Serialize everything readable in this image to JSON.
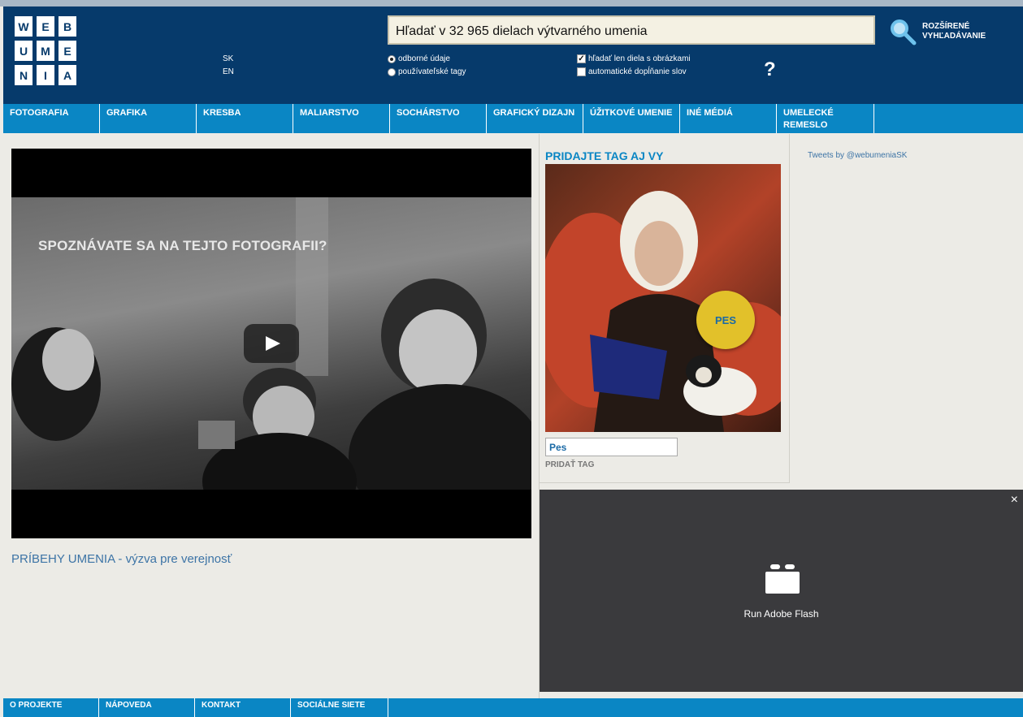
{
  "logo": {
    "letters": [
      "W",
      "E",
      "B",
      "U",
      "M",
      "E",
      "N",
      "I",
      "A"
    ]
  },
  "languages": [
    "SK",
    "EN"
  ],
  "search": {
    "value": "Hľadať v 32 965 dielach výtvarného umenia"
  },
  "search_options": {
    "odborne": "odborné údaje",
    "tagy": "používateľské tagy",
    "obrazky": "hľadať len diela s obrázkami",
    "doplnanie": "automatické dopĺňanie slov"
  },
  "help": "?",
  "advanced": {
    "line1": "ROZŠÍRENÉ",
    "line2": "VYHĽADÁVANIE"
  },
  "nav": [
    "FOTOGRAFIA",
    "GRAFIKA",
    "KRESBA",
    "MALIARSTVO",
    "SOCHÁRSTVO",
    "GRAFICKÝ DIZAJN",
    "ÚŽITKOVÉ UMENIE",
    "INÉ MÉDIÁ",
    "UMELECKÉ REMESLO"
  ],
  "video": {
    "caption": "SPOZNÁVATE SA NA TEJTO FOTOGRAFII?"
  },
  "story_link": "PRÍBEHY UMENIA - výzva pre verejnosť",
  "tag_section": {
    "title": "PRIDAJTE TAG AJ VY",
    "bubble": "PES",
    "input_value": "Pes",
    "add_label": "PRIDAŤ TAG"
  },
  "tweets": "Tweets by @webumeniaSK",
  "flash": {
    "close": "×",
    "label": "Run Adobe Flash"
  },
  "footer": [
    "O PROJEKTE",
    "NÁPOVEDA",
    "KONTAKT",
    "SOCIÁLNE SIETE"
  ],
  "colors": {
    "header": "#063a6b",
    "nav": "#0a86c4",
    "accent_yellow": "#e2c12a"
  }
}
